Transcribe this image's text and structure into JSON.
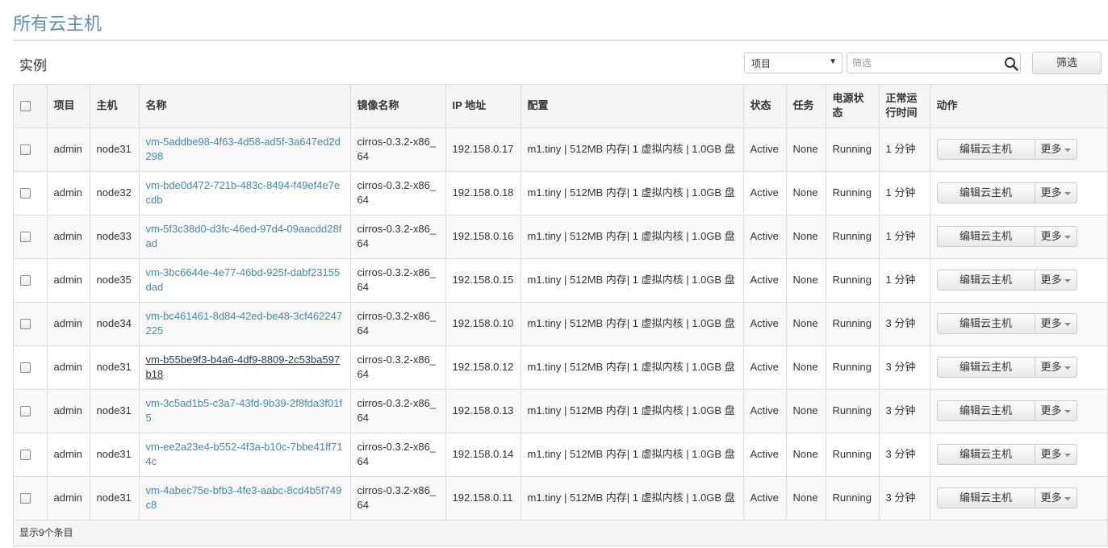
{
  "page": {
    "title": "所有云主机",
    "section": "实例"
  },
  "filter": {
    "select_value": "项目",
    "input_placeholder": "筛选",
    "button_label": "筛选"
  },
  "table": {
    "headers": {
      "project": "项目",
      "host": "主机",
      "name": "名称",
      "image": "镜像名称",
      "ip": "IP 地址",
      "flavor": "配置",
      "status": "状态",
      "task": "任务",
      "power": "电源状态",
      "uptime": "正常运行时间",
      "actions": "动作"
    },
    "edit_label": "编辑云主机",
    "more_label": "更多",
    "rows": [
      {
        "project": "admin",
        "host": "node31",
        "name": "vm-5addbe98-4f63-4d58-ad5f-3a647ed2d298",
        "image": "cirros-0.3.2-x86_64",
        "ip": "192.158.0.17",
        "flavor": "m1.tiny | 512MB 内存| 1 虚拟内核 | 1.0GB 盘",
        "status": "Active",
        "task": "None",
        "power": "Running",
        "uptime": "1 分钟"
      },
      {
        "project": "admin",
        "host": "node32",
        "name": "vm-bde0d472-721b-483c-8494-f49ef4e7ecdb",
        "image": "cirros-0.3.2-x86_64",
        "ip": "192.158.0.18",
        "flavor": "m1.tiny | 512MB 内存| 1 虚拟内核 | 1.0GB 盘",
        "status": "Active",
        "task": "None",
        "power": "Running",
        "uptime": "1 分钟"
      },
      {
        "project": "admin",
        "host": "node33",
        "name": "vm-5f3c38d0-d3fc-46ed-97d4-09aacdd28fad",
        "image": "cirros-0.3.2-x86_64",
        "ip": "192.158.0.16",
        "flavor": "m1.tiny | 512MB 内存| 1 虚拟内核 | 1.0GB 盘",
        "status": "Active",
        "task": "None",
        "power": "Running",
        "uptime": "1 分钟"
      },
      {
        "project": "admin",
        "host": "node35",
        "name": "vm-3bc6644e-4e77-46bd-925f-dabf23155dad",
        "image": "cirros-0.3.2-x86_64",
        "ip": "192.158.0.15",
        "flavor": "m1.tiny | 512MB 内存| 1 虚拟内核 | 1.0GB 盘",
        "status": "Active",
        "task": "None",
        "power": "Running",
        "uptime": "1 分钟"
      },
      {
        "project": "admin",
        "host": "node34",
        "name": "vm-bc461461-8d84-42ed-be48-3cf462247225",
        "image": "cirros-0.3.2-x86_64",
        "ip": "192.158.0.10",
        "flavor": "m1.tiny | 512MB 内存| 1 虚拟内核 | 1.0GB 盘",
        "status": "Active",
        "task": "None",
        "power": "Running",
        "uptime": "3 分钟"
      },
      {
        "project": "admin",
        "host": "node31",
        "name": "vm-b55be9f3-b4a6-4df9-8809-2c53ba597b18",
        "image": "cirros-0.3.2-x86_64",
        "ip": "192.158.0.12",
        "flavor": "m1.tiny | 512MB 内存| 1 虚拟内核 | 1.0GB 盘",
        "status": "Active",
        "task": "None",
        "power": "Running",
        "uptime": "3 分钟"
      },
      {
        "project": "admin",
        "host": "node31",
        "name": "vm-3c5ad1b5-c3a7-43fd-9b39-2f8fda3f01f5",
        "image": "cirros-0.3.2-x86_64",
        "ip": "192.158.0.13",
        "flavor": "m1.tiny | 512MB 内存| 1 虚拟内核 | 1.0GB 盘",
        "status": "Active",
        "task": "None",
        "power": "Running",
        "uptime": "3 分钟"
      },
      {
        "project": "admin",
        "host": "node31",
        "name": "vm-ee2a23e4-b552-4f3a-b10c-7bbe41ff714c",
        "image": "cirros-0.3.2-x86_64",
        "ip": "192.158.0.14",
        "flavor": "m1.tiny | 512MB 内存| 1 虚拟内核 | 1.0GB 盘",
        "status": "Active",
        "task": "None",
        "power": "Running",
        "uptime": "3 分钟"
      },
      {
        "project": "admin",
        "host": "node31",
        "name": "vm-4abec75e-bfb3-4fe3-aabc-8cd4b5f749c8",
        "image": "cirros-0.3.2-x86_64",
        "ip": "192.158.0.11",
        "flavor": "m1.tiny | 512MB 内存| 1 虚拟内核 | 1.0GB 盘",
        "status": "Active",
        "task": "None",
        "power": "Running",
        "uptime": "3 分钟"
      }
    ],
    "footer": "显示9个条目"
  },
  "colors": {
    "title": "#5b8fb0",
    "link": "#3c8dbc",
    "link_active": "#1f3a5a"
  }
}
